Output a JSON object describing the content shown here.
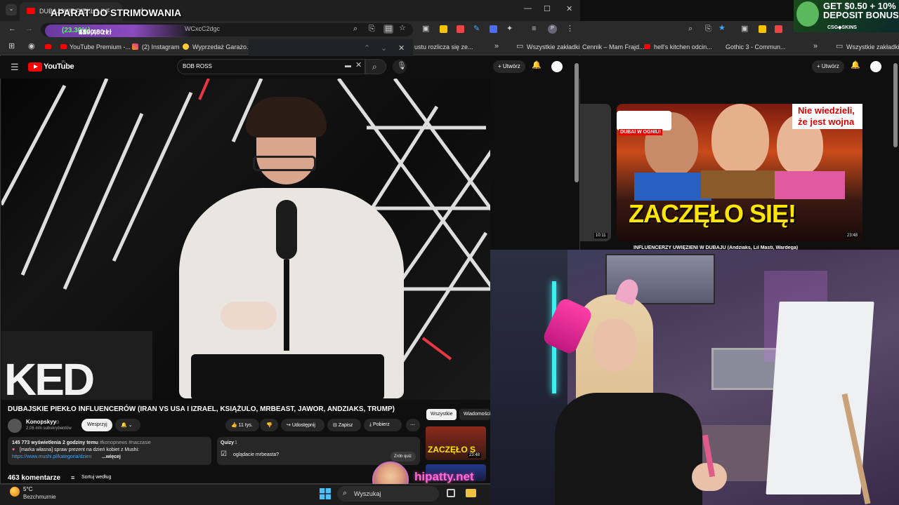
{
  "overlay": {
    "stream_title": "APARAT DO STRIMOWANIA",
    "donation_current": "419,48 zł",
    "donation_sep": "z",
    "donation_goal": "1800,00 zł",
    "donation_pct": "(23.30%)",
    "donation_progress": 0.233,
    "watermark": "hipatty.net"
  },
  "browser_left": {
    "tab_title": "DUBAJSKIE PIEKŁO INFLUEN",
    "url_tail": "WCxcC2dgc",
    "bookmarks": [
      "YouTube Premium -...",
      "(2) Instagram",
      "Wyprzedaż Garażo...",
      "ustu rozlicza się ze..."
    ],
    "all_bookmarks": "Wszystkie zakładki"
  },
  "browser_right": {
    "bookmarks": [
      "Cennik – Mam Frajd...",
      "hell's kitchen odcin...",
      "Gothic 3 - Commun..."
    ],
    "all_bookmarks": "Wszystkie zakładki",
    "create_label": "Utwórz",
    "thumb_side_duration": "10:11",
    "thumb_main_duration": "23:48",
    "thumb_headline": "ZACZĘŁO SIĘ!",
    "thumb_corner": "Nie wiedzieli,\nże jest wojna",
    "thumb_badge": "DUBAI W OGNIU!",
    "next_title": "INFLUENCERZY UWIĘZIENI W DUBAJU (Andziaks, Lil Masti, Wardega)"
  },
  "youtube": {
    "logo": "YouTube",
    "region": "PL",
    "search_value": "BOB ROSS",
    "create_label": "Utwórz",
    "video_title": "DUBAJSKIE PIEKŁO INFLUENCERÓW (IRAN VS USA I IZRAEL, KSIĄŻULO, MRBEAST, JAWOR, ANDZIAKS, TRUMP)",
    "channel_name": "Konopskyy",
    "channel_subs": "2,06 mln subskrybentów",
    "support_label": "Wesprzyj",
    "likes": "11 tys.",
    "share_label": "Udostępnij",
    "save_label": "Zapisz",
    "download_label": "Pobierz",
    "desc_stats": "145 773 wyświetlenia  2 godziny temu",
    "desc_tags": "#konopnews #naczasie",
    "desc_line2": "[marka własna] spraw prezent na dzień kobiet z Mushi:",
    "desc_link": "https://www.mushi.pl/kategoria/dzien",
    "desc_more": "...więcej",
    "quiz_label": "Quizy",
    "quiz_count": "1",
    "quiz_question": "oglądacie mrbeasta?",
    "quiz_button": "Zrób quiz",
    "chips": [
      "Wszystkie",
      "Wiadomości"
    ],
    "related_duration": "23:48",
    "related_thumb_text": "ZACZĘŁO S",
    "comments_count": "463 komentarze",
    "sort_label": "Sortuj według",
    "video_overlay_text": "KED"
  },
  "ad": {
    "line1": "GET $0.50 + 10%",
    "line2": "DEPOSIT BONUS",
    "brand": "CSG◆SKINS"
  },
  "taskbar": {
    "temp": "5°C",
    "weather": "Bezchmurnie",
    "search_placeholder": "Wyszukaj"
  }
}
